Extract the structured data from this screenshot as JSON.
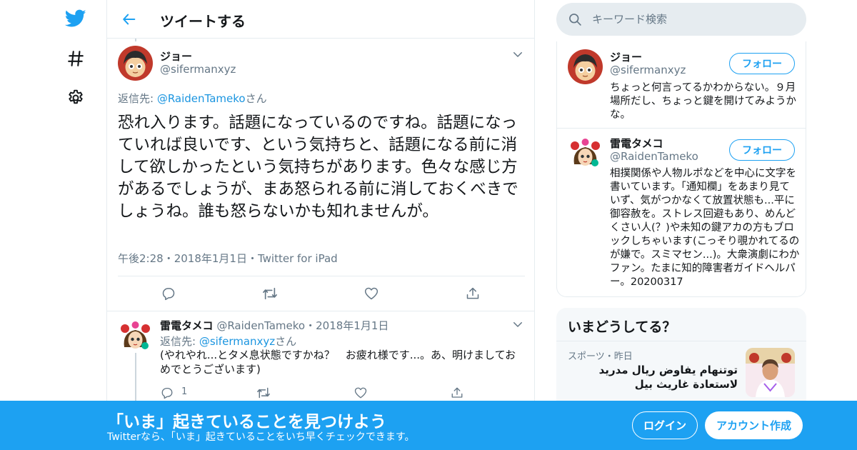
{
  "colors": {
    "accent": "#1da1f2",
    "link": "#1b95e0",
    "secondary_text": "#657786",
    "border": "#e6ecf0"
  },
  "nav": {
    "icons": [
      "twitter-bird-icon",
      "hashtag-icon",
      "gear-icon"
    ]
  },
  "header": {
    "title": "ツイートする"
  },
  "main_tweet": {
    "name": "ジョー",
    "handle": "@sifermanxyz",
    "reply_prefix": "返信先: ",
    "reply_user": "@RaidenTameko",
    "reply_suffix": "さん",
    "text": "恐れ入ります。話題になっているのですね。話題になっていれば良いです、という気持ちと、話題になる前に消して欲しかったという気持ちがあります。色々な感じ方があるでしょうが、まあ怒られる前に消しておくべきでしょうね。誰も怒らないかも知れませんが。",
    "time": "午後2:28",
    "sep": "・",
    "date": "2018年1月1日",
    "source": "Twitter for iPad"
  },
  "reply_tweet": {
    "name": "雷電タメコ",
    "handle": "@RaidenTameko",
    "sep": "・",
    "date": "2018年1月1日",
    "reply_prefix": "返信先: ",
    "reply_user": "@sifermanxyz",
    "reply_suffix": "さん",
    "text": "(やれやれ...とタメ息状態ですかね？　お疲れ様です...。あ、明けましておめでとうございます)",
    "reply_count": "1"
  },
  "search": {
    "placeholder": "キーワード検索"
  },
  "users": [
    {
      "name": "ジョー",
      "handle": "@sifermanxyz",
      "follow_label": "フォロー",
      "bio": "ちょっと何言ってるかわからない。９月場所だし、ちょっと鍵を開けてみようかな。"
    },
    {
      "name": "雷電タメコ",
      "handle": "@RaidenTameko",
      "follow_label": "フォロー",
      "bio": "相撲関係や人物ルポなどを中心に文字を書いています。「通知欄」をあまり見ていず、気がつかなくて放置状態も...平に御容赦を。ストレス回避もあり、めんどくさい人(？)や未知の鍵アカの方もブロックしちゃいます(こっそり覗かれてるのが嫌で。スミマセン...)。大衆演劇にわかファン。たまに知的障害者ガイドヘルパー。20200317"
    }
  ],
  "trends": {
    "title": "いまどうしてる？",
    "items": [
      {
        "meta": "スポーツ・昨日",
        "text": "توتنهام يفاوض ريال مدريد لاستعادة غاريث بيل"
      }
    ]
  },
  "banner": {
    "title": "「いま」起きていることを見つけよう",
    "subtitle": "Twitterなら、「いま」起きていることをいち早くチェックできます。",
    "login_label": "ログイン",
    "signup_label": "アカウント作成"
  }
}
